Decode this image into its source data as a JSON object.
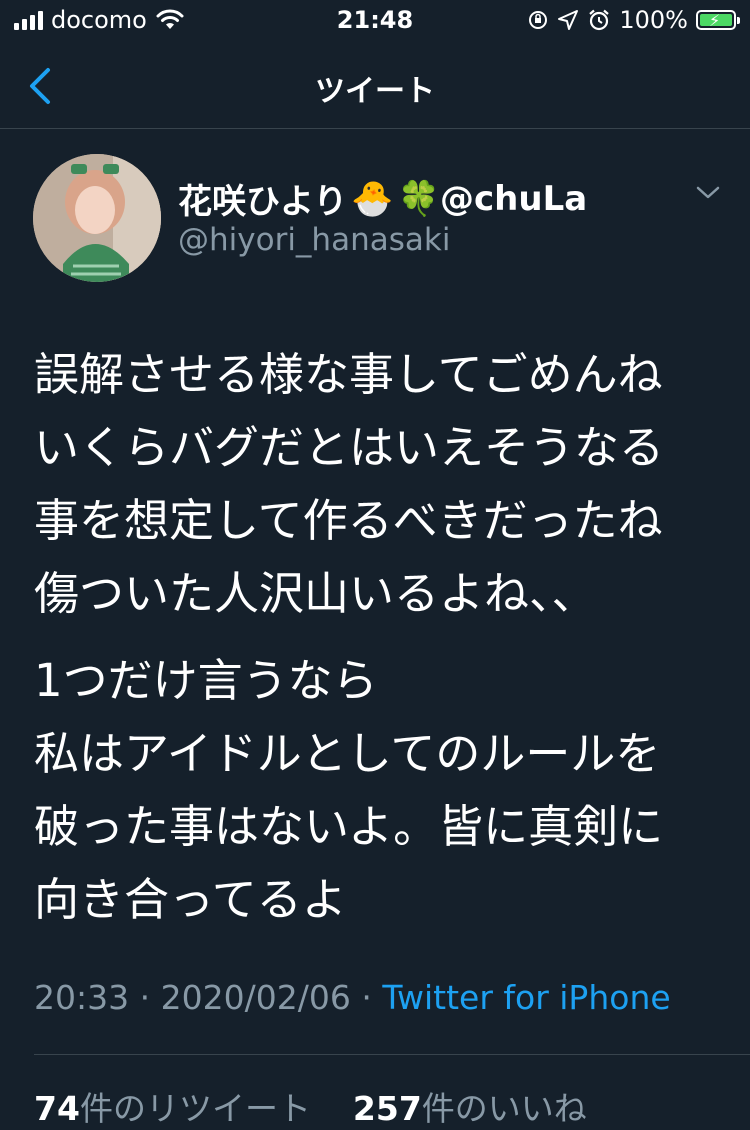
{
  "status_bar": {
    "carrier": "docomo",
    "time": "21:48",
    "battery": "100%",
    "battery_level": 1.0
  },
  "nav": {
    "title": "ツイート",
    "back_icon": "chevron-left-icon"
  },
  "tweet": {
    "display_name": "花咲ひより",
    "name_emojis": [
      "🐣",
      "🍀"
    ],
    "name_suffix": "@chuLa",
    "handle": "@hiyori_hanasaki",
    "paragraph1": [
      "誤解させる様な事してごめんね",
      "いくらバグだとはいえそうなる",
      "事を想定して作るべきだったね",
      "傷ついた人沢山いるよね、、"
    ],
    "paragraph2": [
      "1つだけ言うなら",
      "私はアイドルとしてのルールを",
      "破った事はないよ。皆に真剣に",
      "向き合ってるよ"
    ],
    "time": "20:33",
    "date": "2020/02/06",
    "separator": "·",
    "source": "Twitter for iPhone",
    "retweet_count": "74",
    "retweet_label": "件のリツイート",
    "like_count": "257",
    "like_label": "件のいいね"
  },
  "colors": {
    "background": "#15202b",
    "accent": "#1da1f2",
    "secondary_text": "#8899a6",
    "divider": "#38444d",
    "battery_green": "#4cd964"
  }
}
